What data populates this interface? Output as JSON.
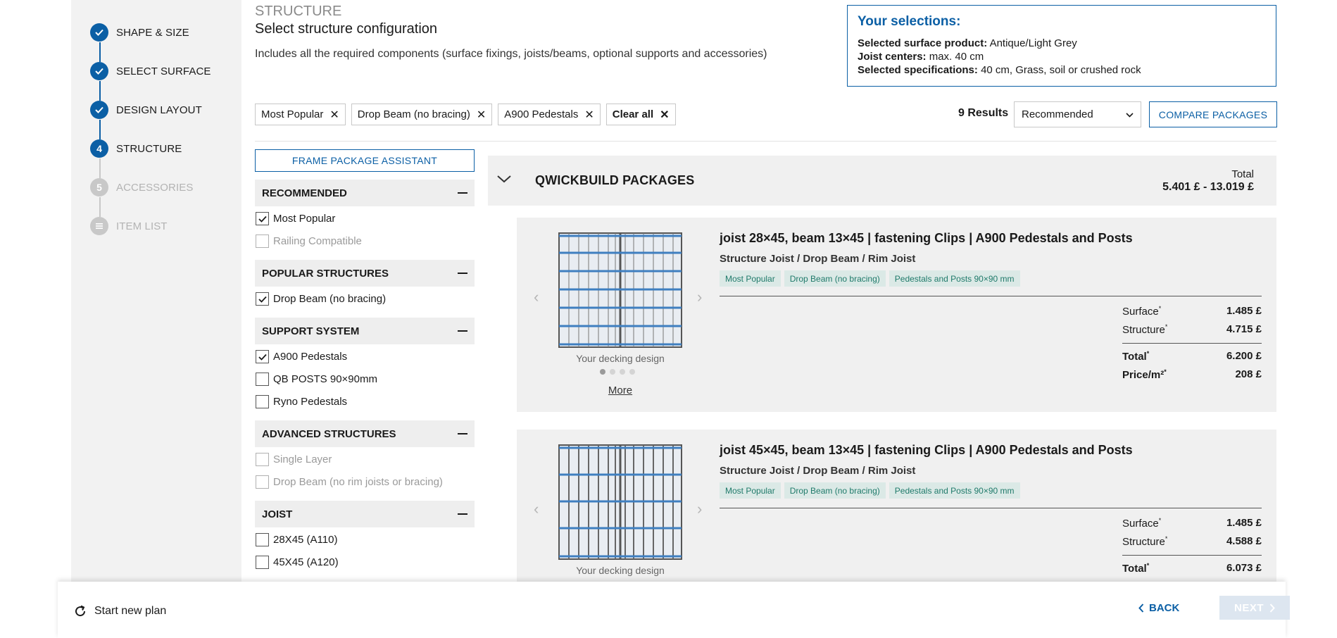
{
  "steps": [
    {
      "label": "SHAPE & SIZE",
      "state": "done"
    },
    {
      "label": "SELECT SURFACE",
      "state": "done"
    },
    {
      "label": "DESIGN LAYOUT",
      "state": "done"
    },
    {
      "label": "STRUCTURE",
      "state": "current",
      "number": "4"
    },
    {
      "label": "ACCESSORIES",
      "state": "upcoming",
      "number": "5"
    },
    {
      "label": "ITEM LIST",
      "state": "upcoming",
      "icon": "list-icon"
    }
  ],
  "header": {
    "kicker": "STRUCTURE",
    "title": "Select structure configuration",
    "description": "Includes all the required components (surface fixings, joists/beams, optional supports and accessories)"
  },
  "selections": {
    "heading": "Your selections:",
    "lines": [
      {
        "label": "Selected surface product:",
        "value": "Antique/Light Grey"
      },
      {
        "label": "Joist centers:",
        "value": "max. 40 cm"
      },
      {
        "label": "Selected specifications:",
        "value": "40 cm, Grass, soil or crushed rock"
      }
    ]
  },
  "active_filters": [
    "Most Popular",
    "Drop Beam (no bracing)",
    "A900 Pedestals"
  ],
  "clear_all_label": "Clear all",
  "results_count": "9 Results",
  "sort": {
    "selected": "Recommended"
  },
  "compare_label": "COMPARE PACKAGES",
  "assistant_label": "FRAME PACKAGE ASSISTANT",
  "filter_groups": [
    {
      "title": "RECOMMENDED",
      "options": [
        {
          "label": "Most Popular",
          "checked": true,
          "disabled": false
        },
        {
          "label": "Railing Compatible",
          "checked": false,
          "disabled": true
        }
      ]
    },
    {
      "title": "POPULAR STRUCTURES",
      "options": [
        {
          "label": "Drop Beam (no bracing)",
          "checked": true,
          "disabled": false
        }
      ]
    },
    {
      "title": "SUPPORT SYSTEM",
      "options": [
        {
          "label": "A900 Pedestals",
          "checked": true,
          "disabled": false
        },
        {
          "label": "QB POSTS 90×90mm",
          "checked": false,
          "disabled": false
        },
        {
          "label": "Ryno Pedestals",
          "checked": false,
          "disabled": false
        }
      ]
    },
    {
      "title": "ADVANCED STRUCTURES",
      "options": [
        {
          "label": "Single Layer",
          "checked": false,
          "disabled": true
        },
        {
          "label": "Drop Beam (no rim joists or bracing)",
          "checked": false,
          "disabled": true
        }
      ]
    },
    {
      "title": "JOIST",
      "options": [
        {
          "label": "28X45 (A110)",
          "checked": false,
          "disabled": false
        },
        {
          "label": "45X45 (A120)",
          "checked": false,
          "disabled": false
        }
      ]
    }
  ],
  "package_section": {
    "title": "QWICKBUILD PACKAGES",
    "total_label": "Total",
    "total_value": "5.401 £ - 13.019 £"
  },
  "packages": [
    {
      "title": "joist 28×45, beam 13×45 | fastening Clips | A900 Pedestals and Posts",
      "subtitle": "Structure Joist / Drop Beam / Rim Joist",
      "tags": [
        "Most Popular",
        "Drop Beam (no bracing)",
        "Pedestals and Posts 90×90 mm"
      ],
      "image_caption": "Your decking design",
      "more_label": "More",
      "surface_label": "Surface",
      "surface_value": "1.485 £",
      "structure_label": "Structure",
      "structure_value": "4.715 £",
      "total_label": "Total",
      "total_value": "6.200 £",
      "price_m2_label": "Price/m²",
      "price_m2_value": "208 £"
    },
    {
      "title": "joist 45×45, beam 13×45 | fastening Clips | A900 Pedestals and Posts",
      "subtitle": "Structure Joist / Drop Beam / Rim Joist",
      "tags": [
        "Most Popular",
        "Drop Beam (no bracing)",
        "Pedestals and Posts 90×90 mm"
      ],
      "image_caption": "Your decking design",
      "surface_label": "Surface",
      "surface_value": "1.485 £",
      "structure_label": "Structure",
      "structure_value": "4.588 £",
      "total_label": "Total",
      "total_value": "6.073 £"
    }
  ],
  "footer": {
    "restart_label": "Start new plan",
    "back_label": "BACK",
    "next_label": "NEXT"
  },
  "colors": {
    "accent": "#0b5fa5",
    "tag_bg": "#dbe9e6",
    "tag_text": "#1f7a6a",
    "panel": "#f0f0f0"
  }
}
